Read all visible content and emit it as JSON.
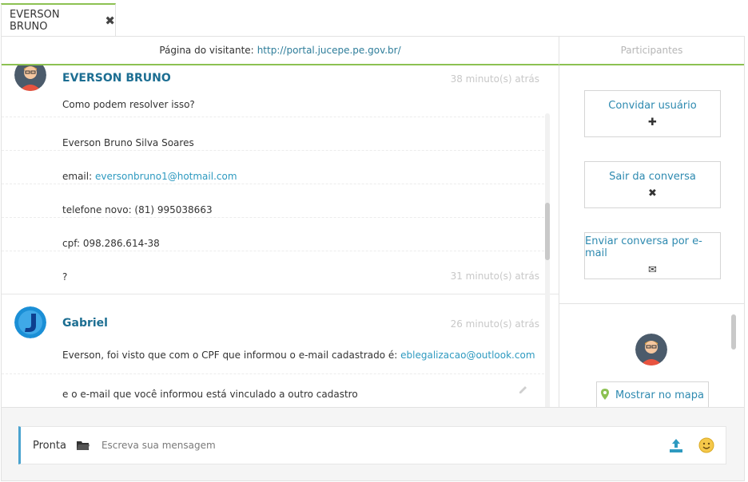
{
  "tab": {
    "label": "EVERSON BRUNO",
    "close_icon": "close-icon"
  },
  "visitor_bar": {
    "prefix": "Página do visitante:",
    "url": "http://portal.jucepe.pe.gov.br/"
  },
  "participants_header": "Participantes",
  "messages": [
    {
      "sender": "EVERSON BRUNO",
      "time_top": "38 minuto(s) atrás",
      "lines": [
        {
          "text": "Como podem resolver isso?"
        },
        {
          "text": "Everson Bruno Silva Soares"
        },
        {
          "prefix": "email:",
          "link": "eversonbruno1@hotmail.com"
        },
        {
          "text": "telefone novo: (81) 995038663"
        },
        {
          "text": "cpf: 098.286.614-38"
        },
        {
          "text": "?"
        }
      ],
      "time_bottom": "31 minuto(s) atrás"
    },
    {
      "sender": "Gabriel",
      "time_top": "26 minuto(s) atrás",
      "lines": [
        {
          "prefix": "Everson, foi visto que com o CPF que informou o e-mail cadastrado é:",
          "link": "eblegalizacao@outlook.com"
        },
        {
          "text": "e o e-mail que você informou está vinculado a outro cadastro"
        }
      ]
    }
  ],
  "side_buttons": [
    {
      "label": "Convidar usuário",
      "icon": "plus-icon",
      "glyph": "✚"
    },
    {
      "label": "Sair da conversa",
      "icon": "close-icon",
      "glyph": "✖"
    },
    {
      "label": "Enviar conversa por e-mail",
      "icon": "envelope-icon",
      "glyph": "✉"
    }
  ],
  "map_button": {
    "label": "Mostrar no mapa",
    "icon": "map-marker-icon"
  },
  "composer": {
    "status": "Pronta",
    "placeholder": "Escreva sua mensagem"
  },
  "colors": {
    "accent_green": "#8cc152",
    "link_blue": "#2e8ab0",
    "sender_blue": "#1c6e92",
    "composer_border": "#4aa3cf"
  }
}
